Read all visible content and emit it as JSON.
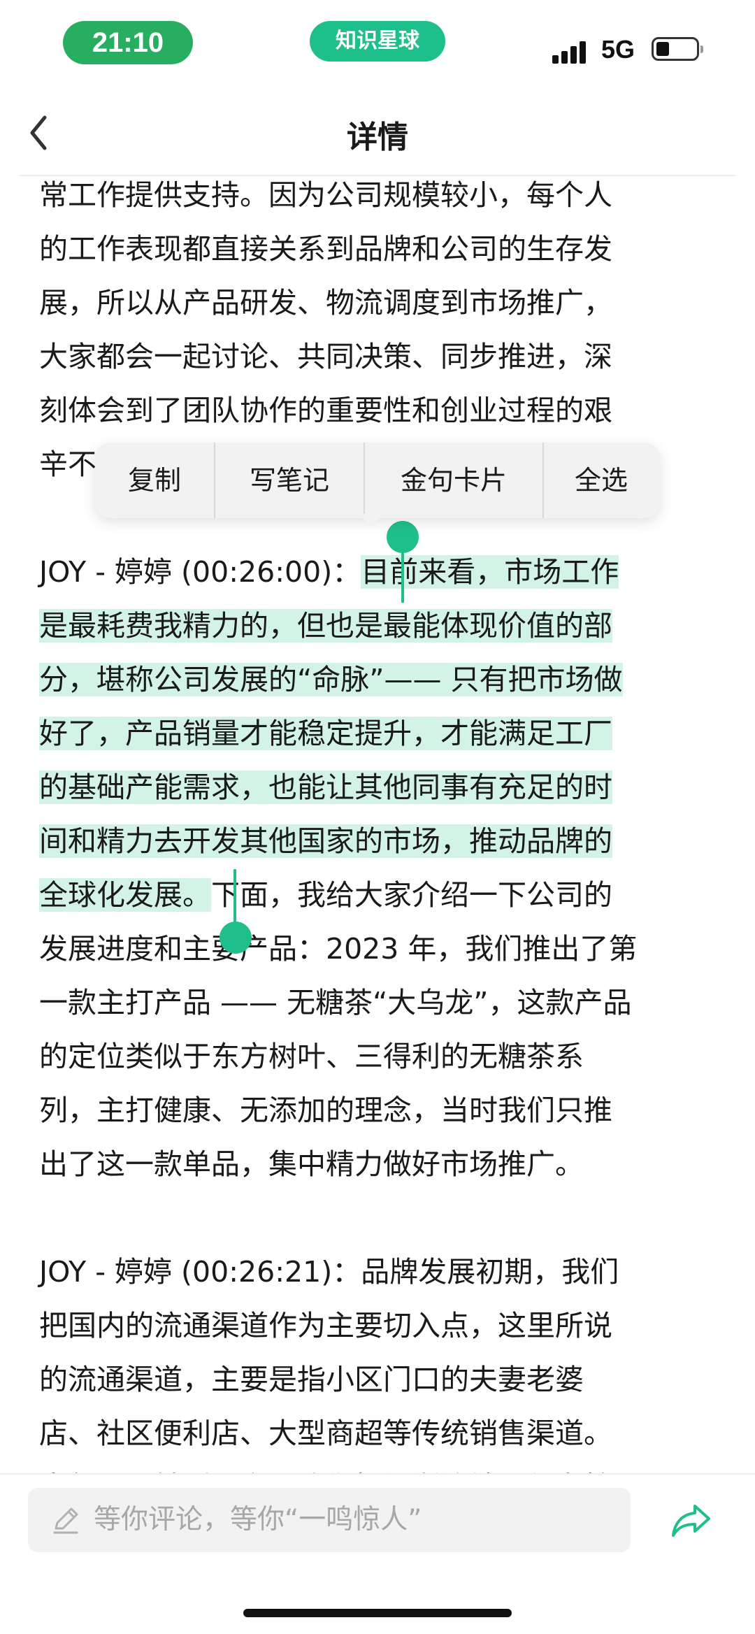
{
  "status_bar": {
    "time": "21:10",
    "app_pill": "知识星球",
    "network": "5G",
    "accent_time": "#27ae60",
    "accent_app": "#1dbf8b"
  },
  "nav": {
    "title": "详情",
    "back_icon": "chevron-left-icon"
  },
  "context_menu": {
    "items": [
      "复制",
      "写笔记",
      "金句卡片",
      "全选"
    ]
  },
  "article": {
    "p1": "常工作提供支持。因为公司规模较小，每个人\n的工作表现都直接关系到品牌和公司的生存发\n展，所以从产品研发、物流调度到市场推广，\n大家都会一起讨论、共同决策、同步推进，深\n刻体会到了团队协作的重要性和创业过程的艰\n辛不易。",
    "p2_prefix": "JOY - 婷婷 (00:26:00)：",
    "p2_selected": "目前来看，市场工作\n是最耗费我精力的，但也是最能体现价值的部\n分，堪称公司发展的“命脉”—— 只有把市场做\n好了，产品销量才能稳定提升，才能满足工厂\n的基础产能需求，也能让其他同事有充足的时\n间和精力去开发其他国家的市场，推动品牌的\n全球化发展。",
    "p2_rest": "下面，我给大家介绍一下公司的\n发展进度和主要产品：2023 年，我们推出了第\n一款主打产品 —— 无糖茶“大乌龙”，这款产品\n的定位类似于东方树叶、三得利的无糖茶系\n列，主打健康、无添加的理念，当时我们只推\n出了这一款单品，集中精力做好市场推广。",
    "p3": "JOY - 婷婷 (00:26:21)：品牌发展初期，我们\n把国内的流通渠道作为主要切入点，这里所说\n的流通渠道，主要是指小区门口的夫妻老婆\n店、社区便利店、大型商超等传统销售渠道。\n去年公司转型上海，我们把江浙沪地区作为核",
    "selection_color": "#d3f3e7",
    "handle_color": "#1fbf8b"
  },
  "bottom_bar": {
    "comment_placeholder": "等你评论，等你“一鸣惊人”",
    "comment_icon": "pencil-icon",
    "share_icon": "share-icon",
    "share_color": "#1fbf8b"
  }
}
